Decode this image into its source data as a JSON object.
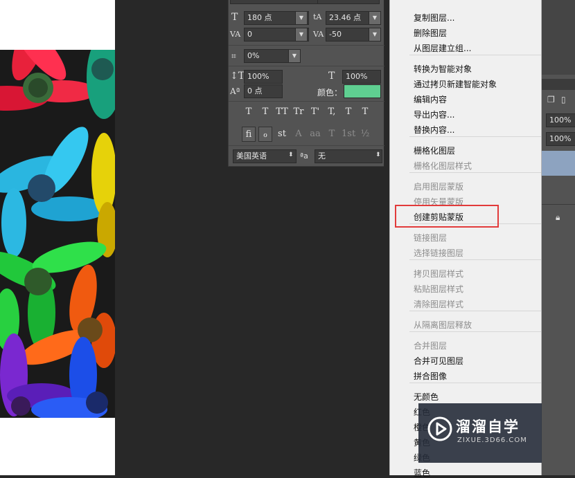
{
  "character_panel": {
    "font_size": "180 点",
    "leading": "23.46 点",
    "kerning": "0",
    "tracking": "-50",
    "tsume": "0%",
    "vertical_scale": "100%",
    "horizontal_scale": "100%",
    "baseline_shift": "0 点",
    "color_label": "颜色：",
    "color_value": "#5fcf91",
    "language": "美国英语",
    "aa_label": "ªa",
    "anti_alias": "无",
    "type_buttons": [
      "T",
      "T",
      "TT",
      "Tr",
      "T'",
      "T,",
      "T",
      "T"
    ],
    "opentype_buttons": [
      "fi",
      "ℴ",
      "st",
      "A",
      "aa",
      "T",
      "1st",
      "½"
    ]
  },
  "context_menu": {
    "groups": [
      [
        {
          "label": "复制图层...",
          "enabled": true
        },
        {
          "label": "删除图层",
          "enabled": true
        },
        {
          "label": "从图层建立组...",
          "enabled": true
        }
      ],
      [
        {
          "label": "转换为智能对象",
          "enabled": true
        },
        {
          "label": "通过拷贝新建智能对象",
          "enabled": true
        },
        {
          "label": "编辑内容",
          "enabled": true
        },
        {
          "label": "导出内容...",
          "enabled": true
        },
        {
          "label": "替换内容...",
          "enabled": true
        }
      ],
      [
        {
          "label": "栅格化图层",
          "enabled": true
        },
        {
          "label": "栅格化图层样式",
          "enabled": false
        }
      ],
      [
        {
          "label": "启用图层蒙版",
          "enabled": false
        },
        {
          "label": "停用矢量蒙版",
          "enabled": false
        },
        {
          "label": "创建剪贴蒙版",
          "enabled": true
        }
      ],
      [
        {
          "label": "链接图层",
          "enabled": false
        },
        {
          "label": "选择链接图层",
          "enabled": false
        }
      ],
      [
        {
          "label": "拷贝图层样式",
          "enabled": false
        },
        {
          "label": "粘贴图层样式",
          "enabled": false
        },
        {
          "label": "清除图层样式",
          "enabled": false
        }
      ],
      [
        {
          "label": "从隔离图层释放",
          "enabled": false
        }
      ],
      [
        {
          "label": "合并图层",
          "enabled": false
        },
        {
          "label": "合并可见图层",
          "enabled": true
        },
        {
          "label": "拼合图像",
          "enabled": true
        }
      ],
      [
        {
          "label": "无颜色",
          "enabled": true
        },
        {
          "label": "红色",
          "enabled": true
        },
        {
          "label": "橙色",
          "enabled": true
        },
        {
          "label": "黄色",
          "enabled": true
        },
        {
          "label": "绿色",
          "enabled": true
        },
        {
          "label": "蓝色",
          "enabled": true
        }
      ]
    ],
    "highlight_color": "#e23a3a"
  },
  "layers_panel": {
    "opacity": "100%",
    "fill": "100%"
  },
  "watermark": {
    "title": "溜溜自学",
    "subtitle": "ZIXUE.3D66.COM"
  }
}
